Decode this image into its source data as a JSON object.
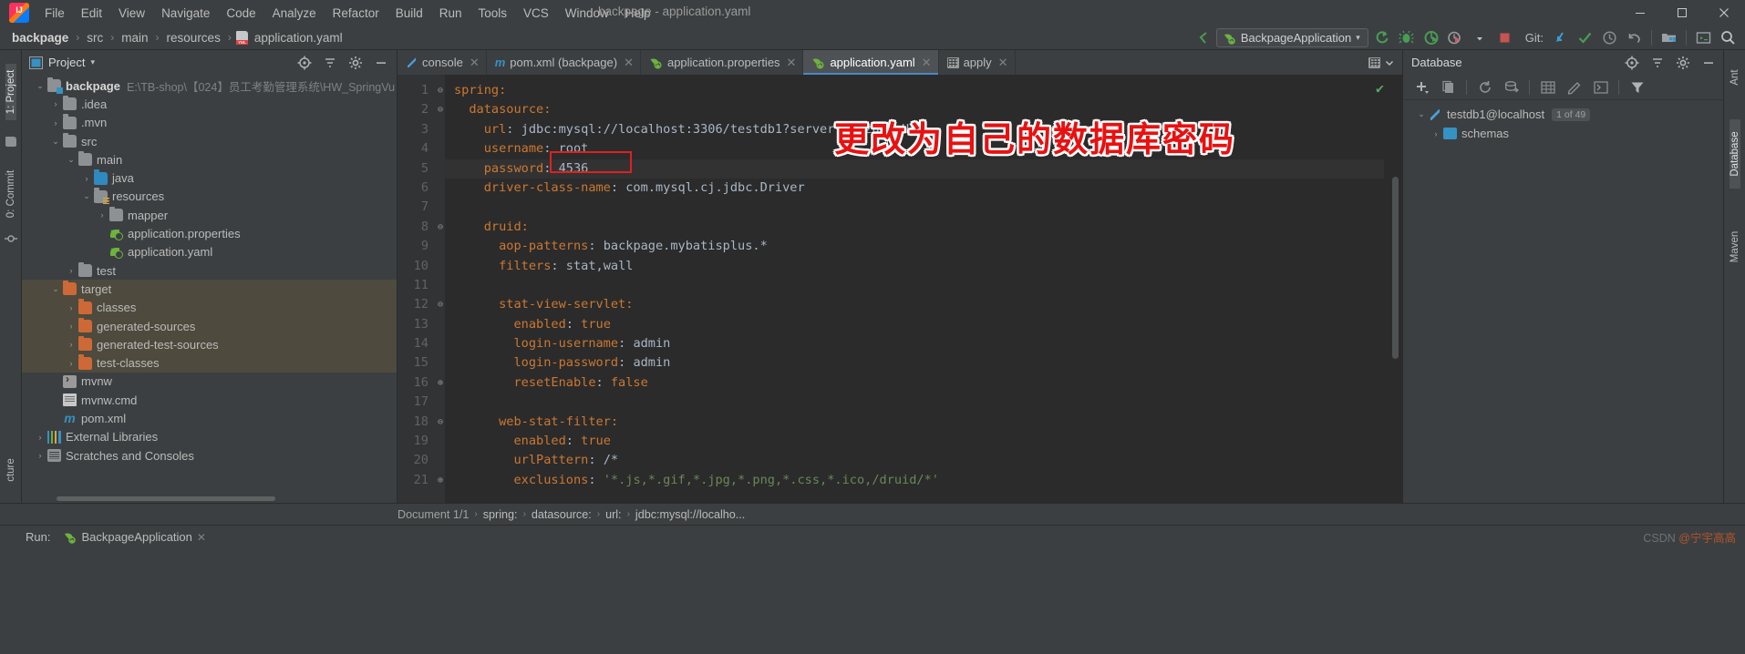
{
  "window": {
    "title": "backpage - application.yaml",
    "controls": {
      "minimize": "—",
      "maximize": "❐",
      "close": "✕"
    }
  },
  "menu": {
    "items": [
      "File",
      "Edit",
      "View",
      "Navigate",
      "Code",
      "Analyze",
      "Refactor",
      "Build",
      "Run",
      "Tools",
      "VCS",
      "Window",
      "Help"
    ]
  },
  "breadcrumb": {
    "items": [
      "backpage",
      "src",
      "main",
      "resources",
      "application.yaml"
    ],
    "separator": "›"
  },
  "toolbar": {
    "run_configuration": "BackpageApplication",
    "dropdown_caret": "▾",
    "git_label": "Git:",
    "buttons": [
      "run-button",
      "debug-button",
      "run-coverage-button",
      "profiler-button",
      "stop-button",
      "git-update-button",
      "git-commit-button",
      "git-history-button",
      "git-rollback-button",
      "project-structure-button",
      "terminal-button",
      "search-everywhere-button"
    ]
  },
  "project_panel": {
    "title": "Project",
    "dropdown_caret": "▾",
    "header_buttons": [
      "locate-icon",
      "collapse-all-icon",
      "settings-icon",
      "hide-icon"
    ],
    "tree": [
      {
        "label": "backpage",
        "path": "E:\\TB-shop\\【024】员工考勤管理系统\\HW_SpringVu",
        "depth": 0,
        "arrow": "⌄",
        "icon": "module-folder",
        "bold": true,
        "highlight": false
      },
      {
        "label": ".idea",
        "path": "",
        "depth": 1,
        "arrow": "›",
        "icon": "folder",
        "bold": false,
        "highlight": false
      },
      {
        "label": ".mvn",
        "path": "",
        "depth": 1,
        "arrow": "›",
        "icon": "folder",
        "bold": false,
        "highlight": false
      },
      {
        "label": "src",
        "path": "",
        "depth": 1,
        "arrow": "⌄",
        "icon": "folder",
        "bold": false,
        "highlight": false
      },
      {
        "label": "main",
        "path": "",
        "depth": 2,
        "arrow": "⌄",
        "icon": "folder",
        "bold": false,
        "highlight": false
      },
      {
        "label": "java",
        "path": "",
        "depth": 3,
        "arrow": "›",
        "icon": "source-folder",
        "bold": false,
        "highlight": false
      },
      {
        "label": "resources",
        "path": "",
        "depth": 3,
        "arrow": "⌄",
        "icon": "resource-folder",
        "bold": false,
        "highlight": false
      },
      {
        "label": "mapper",
        "path": "",
        "depth": 4,
        "arrow": "›",
        "icon": "folder",
        "bold": false,
        "highlight": false
      },
      {
        "label": "application.properties",
        "path": "",
        "depth": 4,
        "arrow": "",
        "icon": "spring-file",
        "bold": false,
        "highlight": false
      },
      {
        "label": "application.yaml",
        "path": "",
        "depth": 4,
        "arrow": "",
        "icon": "spring-file",
        "bold": false,
        "highlight": false
      },
      {
        "label": "test",
        "path": "",
        "depth": 2,
        "arrow": "›",
        "icon": "folder",
        "bold": false,
        "highlight": false
      },
      {
        "label": "target",
        "path": "",
        "depth": 1,
        "arrow": "⌄",
        "icon": "target-folder",
        "bold": false,
        "highlight": true
      },
      {
        "label": "classes",
        "path": "",
        "depth": 2,
        "arrow": "›",
        "icon": "target-folder",
        "bold": false,
        "highlight": true
      },
      {
        "label": "generated-sources",
        "path": "",
        "depth": 2,
        "arrow": "›",
        "icon": "target-folder",
        "bold": false,
        "highlight": true
      },
      {
        "label": "generated-test-sources",
        "path": "",
        "depth": 2,
        "arrow": "›",
        "icon": "target-folder",
        "bold": false,
        "highlight": true
      },
      {
        "label": "test-classes",
        "path": "",
        "depth": 2,
        "arrow": "›",
        "icon": "target-folder",
        "bold": false,
        "highlight": true
      },
      {
        "label": "mvnw",
        "path": "",
        "depth": 1,
        "arrow": "",
        "icon": "shell-file",
        "bold": false,
        "highlight": false
      },
      {
        "label": "mvnw.cmd",
        "path": "",
        "depth": 1,
        "arrow": "",
        "icon": "cmd-file",
        "bold": false,
        "highlight": false
      },
      {
        "label": "pom.xml",
        "path": "",
        "depth": 1,
        "arrow": "",
        "icon": "maven-file",
        "bold": false,
        "highlight": false
      },
      {
        "label": "External Libraries",
        "path": "",
        "depth": 0,
        "arrow": "›",
        "icon": "library",
        "bold": false,
        "highlight": false
      },
      {
        "label": "Scratches and Consoles",
        "path": "",
        "depth": 0,
        "arrow": "›",
        "icon": "scratch",
        "bold": false,
        "highlight": false
      }
    ]
  },
  "left_strip": {
    "tabs": [
      "1: Project",
      "0: Commit"
    ]
  },
  "right_strip": {
    "tabs": [
      "Ant",
      "Database",
      "Maven"
    ]
  },
  "editor": {
    "tabs": [
      {
        "label": "console",
        "icon": "console-icon",
        "active": false,
        "closeable": true
      },
      {
        "label": "pom.xml (backpage)",
        "icon": "maven-icon",
        "active": false,
        "closeable": true
      },
      {
        "label": "application.properties",
        "icon": "spring-icon",
        "active": false,
        "closeable": true
      },
      {
        "label": "application.yaml",
        "icon": "spring-icon",
        "active": true,
        "closeable": true
      },
      {
        "label": "apply",
        "icon": "table-icon",
        "active": false,
        "closeable": true
      }
    ],
    "tabbar_right": [
      "table-icon",
      "chevron-down-icon"
    ],
    "inspection_status": "✔",
    "lines": [
      {
        "n": 1,
        "fold": "⊖",
        "tokens": [
          {
            "t": "spring:",
            "c": "k"
          }
        ]
      },
      {
        "n": 2,
        "fold": "⊖",
        "tokens": [
          {
            "t": "  datasource:",
            "c": "k"
          }
        ]
      },
      {
        "n": 3,
        "fold": "",
        "tokens": [
          {
            "t": "    url",
            "c": "k"
          },
          {
            "t": ": ",
            "c": "v"
          },
          {
            "t": "jdbc:mysql://localhost:3306/testdb1?serverTimezone=UTC",
            "c": "v"
          }
        ]
      },
      {
        "n": 4,
        "fold": "",
        "tokens": [
          {
            "t": "    username",
            "c": "k"
          },
          {
            "t": ": ",
            "c": "v"
          },
          {
            "t": "root",
            "c": "v"
          }
        ]
      },
      {
        "n": 5,
        "fold": "",
        "tokens": [
          {
            "t": "    password",
            "c": "k"
          },
          {
            "t": ": ",
            "c": "v"
          },
          {
            "t": "4536",
            "c": "v"
          }
        ]
      },
      {
        "n": 6,
        "fold": "",
        "tokens": [
          {
            "t": "    driver-class-name",
            "c": "k"
          },
          {
            "t": ": ",
            "c": "v"
          },
          {
            "t": "com.mysql.cj.jdbc.Driver",
            "c": "v"
          }
        ]
      },
      {
        "n": 7,
        "fold": "",
        "tokens": [
          {
            "t": "",
            "c": "v"
          }
        ]
      },
      {
        "n": 8,
        "fold": "⊖",
        "tokens": [
          {
            "t": "    druid:",
            "c": "k"
          }
        ]
      },
      {
        "n": 9,
        "fold": "",
        "tokens": [
          {
            "t": "      aop-patterns",
            "c": "k"
          },
          {
            "t": ": ",
            "c": "v"
          },
          {
            "t": "backpage.mybatisplus.*",
            "c": "v"
          }
        ]
      },
      {
        "n": 10,
        "fold": "",
        "tokens": [
          {
            "t": "      filters",
            "c": "k"
          },
          {
            "t": ": ",
            "c": "v"
          },
          {
            "t": "stat,wall",
            "c": "v"
          }
        ]
      },
      {
        "n": 11,
        "fold": "",
        "tokens": [
          {
            "t": "",
            "c": "v"
          }
        ]
      },
      {
        "n": 12,
        "fold": "⊖",
        "tokens": [
          {
            "t": "      stat-view-servlet:",
            "c": "k"
          }
        ]
      },
      {
        "n": 13,
        "fold": "",
        "tokens": [
          {
            "t": "        enabled",
            "c": "k"
          },
          {
            "t": ": ",
            "c": "v"
          },
          {
            "t": "true",
            "c": "k"
          }
        ]
      },
      {
        "n": 14,
        "fold": "",
        "tokens": [
          {
            "t": "        login-username",
            "c": "k"
          },
          {
            "t": ": ",
            "c": "v"
          },
          {
            "t": "admin",
            "c": "v"
          }
        ]
      },
      {
        "n": 15,
        "fold": "",
        "tokens": [
          {
            "t": "        login-password",
            "c": "k"
          },
          {
            "t": ": ",
            "c": "v"
          },
          {
            "t": "admin",
            "c": "v"
          }
        ]
      },
      {
        "n": 16,
        "fold": "⊕",
        "tokens": [
          {
            "t": "        resetEnable",
            "c": "k"
          },
          {
            "t": ": ",
            "c": "v"
          },
          {
            "t": "false",
            "c": "k"
          }
        ]
      },
      {
        "n": 17,
        "fold": "",
        "tokens": [
          {
            "t": "",
            "c": "v"
          }
        ]
      },
      {
        "n": 18,
        "fold": "⊖",
        "tokens": [
          {
            "t": "      web-stat-filter:",
            "c": "k"
          }
        ]
      },
      {
        "n": 19,
        "fold": "",
        "tokens": [
          {
            "t": "        enabled",
            "c": "k"
          },
          {
            "t": ": ",
            "c": "v"
          },
          {
            "t": "true",
            "c": "k"
          }
        ]
      },
      {
        "n": 20,
        "fold": "",
        "tokens": [
          {
            "t": "        urlPattern",
            "c": "k"
          },
          {
            "t": ": ",
            "c": "v"
          },
          {
            "t": "/*",
            "c": "v"
          }
        ]
      },
      {
        "n": 21,
        "fold": "⊕",
        "tokens": [
          {
            "t": "        exclusions",
            "c": "k"
          },
          {
            "t": ": ",
            "c": "v"
          },
          {
            "t": "'*.js,*.gif,*.jpg,*.png,*.css,*.ico,/druid/*'",
            "c": "s"
          }
        ]
      }
    ],
    "annotation": {
      "text": "更改为自己的数据库密码",
      "color": "#e81111",
      "highlight_box_color": "#e02020",
      "highlighted_value": "4536"
    }
  },
  "database_panel": {
    "title": "Database",
    "header_buttons": [
      "locate-icon",
      "collapse-all-icon",
      "settings-icon",
      "hide-icon"
    ],
    "toolbar_buttons": [
      "add-icon",
      "copy-icon",
      "refresh-icon",
      "sync-icon",
      "table-icon",
      "edit-icon",
      "jump-icon",
      "filter-icon"
    ],
    "tree": [
      {
        "label": "testdb1@localhost",
        "badge": "1 of 49",
        "depth": 0,
        "arrow": "⌄",
        "icon": "mysql-icon"
      },
      {
        "label": "schemas",
        "badge": "",
        "depth": 1,
        "arrow": "›",
        "icon": "schema-icon"
      },
      {
        "label": "",
        "badge": "",
        "depth": 1,
        "arrow": "",
        "icon": ""
      }
    ]
  },
  "statusbar": {
    "document": "Document 1/1",
    "breadcrumb": [
      "spring:",
      "datasource:",
      "url:",
      "jdbc:mysql://localho..."
    ],
    "separator": "›"
  },
  "runbar": {
    "label": "Run:",
    "tab": "BackpageApplication",
    "close": "✕",
    "structure_label": "cture"
  },
  "watermark": {
    "text": "CSDN @宁宇高高",
    "accent": "#b0562c"
  }
}
